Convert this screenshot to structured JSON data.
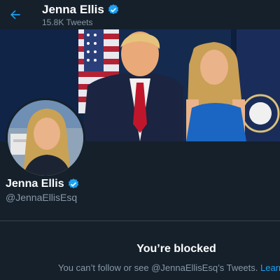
{
  "header": {
    "back_icon": "arrow-left-icon",
    "name": "Jenna Ellis",
    "tweet_count": "15.8K Tweets"
  },
  "profile": {
    "name": "Jenna Ellis",
    "handle": "@JennaEllisEsq",
    "verified_icon": "verified-badge-icon"
  },
  "blocked": {
    "title": "You’re blocked",
    "description": "You can’t follow or see @JennaEllisEsq’s Tweets.",
    "link": "Learn more"
  },
  "colors": {
    "background": "#15202b",
    "accent": "#1da1f2",
    "secondary_text": "#8899a6",
    "divider": "#38444d"
  }
}
